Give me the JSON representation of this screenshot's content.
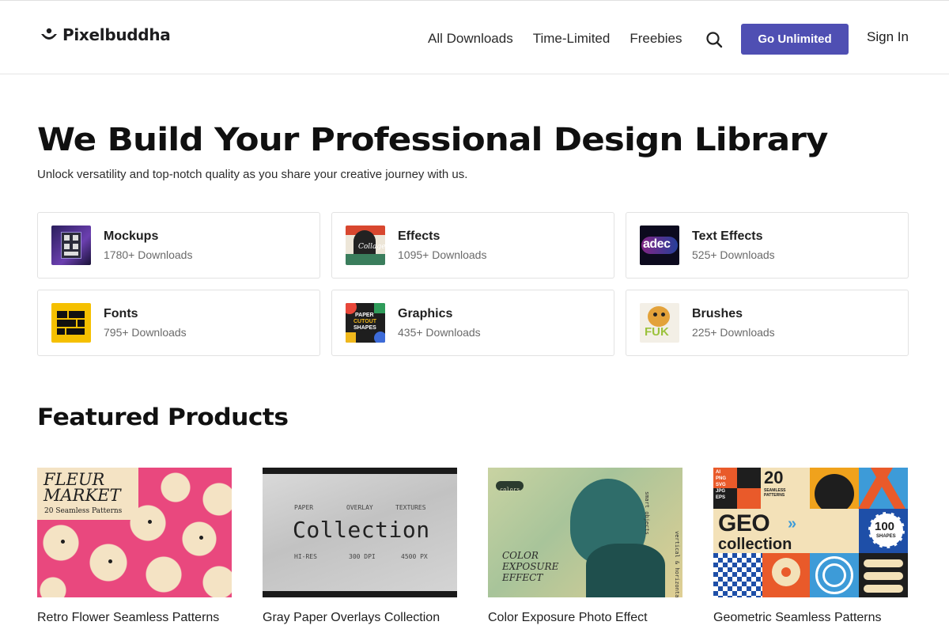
{
  "brand": {
    "name": "Pixelbuddha"
  },
  "nav": {
    "items": [
      "All Downloads",
      "Time-Limited",
      "Freebies"
    ],
    "search_icon": "search-icon",
    "cta_label": "Go Unlimited",
    "signin_label": "Sign In",
    "accent_color": "#4f4fb3"
  },
  "hero": {
    "title": "We Build Your Professional Design Library",
    "subtitle": "Unlock versatility and top-notch quality as you share your creative journey with us."
  },
  "categories": [
    {
      "name": "Mockups",
      "count": "1780+ Downloads"
    },
    {
      "name": "Effects",
      "count": "1095+ Downloads"
    },
    {
      "name": "Text Effects",
      "count": "525+ Downloads"
    },
    {
      "name": "Fonts",
      "count": "795+ Downloads"
    },
    {
      "name": "Graphics",
      "count": "435+ Downloads"
    },
    {
      "name": "Brushes",
      "count": "225+ Downloads"
    }
  ],
  "thumb_text": {
    "effects": "Collage",
    "text_effects": "adec",
    "graphics": [
      "PAPER",
      "CUTOUT",
      "SHAPES"
    ],
    "brushes": "FUK"
  },
  "featured": {
    "title": "Featured Products",
    "products": [
      {
        "name": "Retro Flower Seamless Patterns"
      },
      {
        "name": "Gray Paper Overlays Collection"
      },
      {
        "name": "Color Exposure Photo Effect"
      },
      {
        "name": "Geometric Seamless Patterns"
      }
    ]
  },
  "product_art": {
    "fleur": {
      "title": "FLEUR\nMARKET",
      "sub": "20 Seamless Patterns"
    },
    "paper": {
      "top": [
        "PAPER",
        "OVERLAY",
        "TEXTURES"
      ],
      "title": "Collection",
      "bottom": [
        "HI-RES",
        "300 DPI",
        "4500 PX"
      ]
    },
    "color": {
      "tag": "colors",
      "title": "COLOR\nEXPOSURE\nEFFECT",
      "side": "smart objects",
      "side2": "vertical & horizontal"
    },
    "geo": {
      "formats": [
        "AI",
        "PNG",
        "SVG",
        "JPG",
        "EPS"
      ],
      "count": "20",
      "count_label": "SEAMLESS PATTERNS",
      "title1": "GEO",
      "title2": "collection",
      "badge": "100",
      "badge_label": "SHAPES"
    }
  }
}
